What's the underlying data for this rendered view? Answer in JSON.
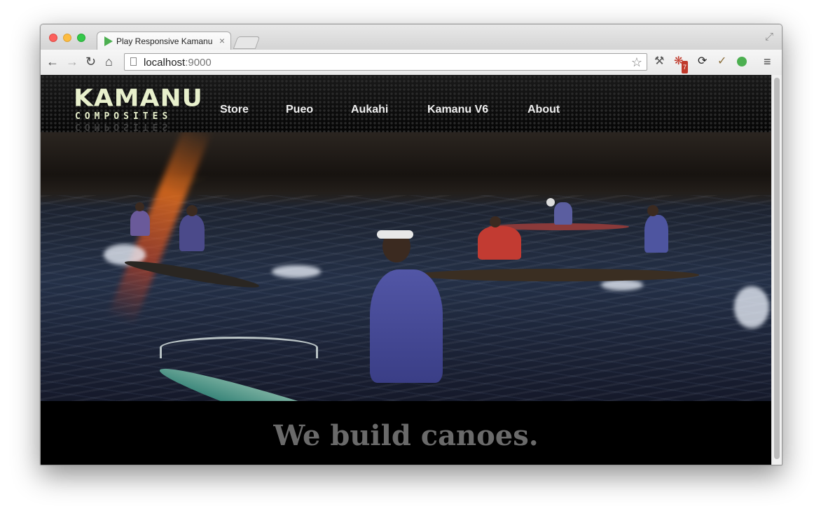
{
  "browser": {
    "tab_title": "Play Responsive Kamanu",
    "tab_close": "×",
    "url_host": "localhost",
    "url_port": ":9000",
    "nav_buttons": {
      "back": "←",
      "forward": "→",
      "reload": "↻",
      "home": "⌂"
    },
    "bookmark_star": "☆",
    "extension_badge": "7",
    "menu": "≡",
    "fullscreen": "⤢"
  },
  "site": {
    "logo_main": "KAMANU",
    "logo_sub": "COMPOSITES",
    "nav": [
      "Store",
      "Pueo",
      "Aukahi",
      "Kamanu V6",
      "About"
    ],
    "tagline": "We build canoes."
  },
  "icons": {
    "favicon": "play-triangle-icon",
    "page": "page-icon",
    "wrench": "wrench-icon",
    "extension": "extension-icon",
    "sync": "sync-icon",
    "eyedropper": "eyedropper-icon",
    "balloon": "green-balloon-icon"
  },
  "colors": {
    "page_background": "#000000",
    "nav_text": "#f0f0f0",
    "logo": "#e8f0cc",
    "tagline": "#6a6a6a"
  }
}
